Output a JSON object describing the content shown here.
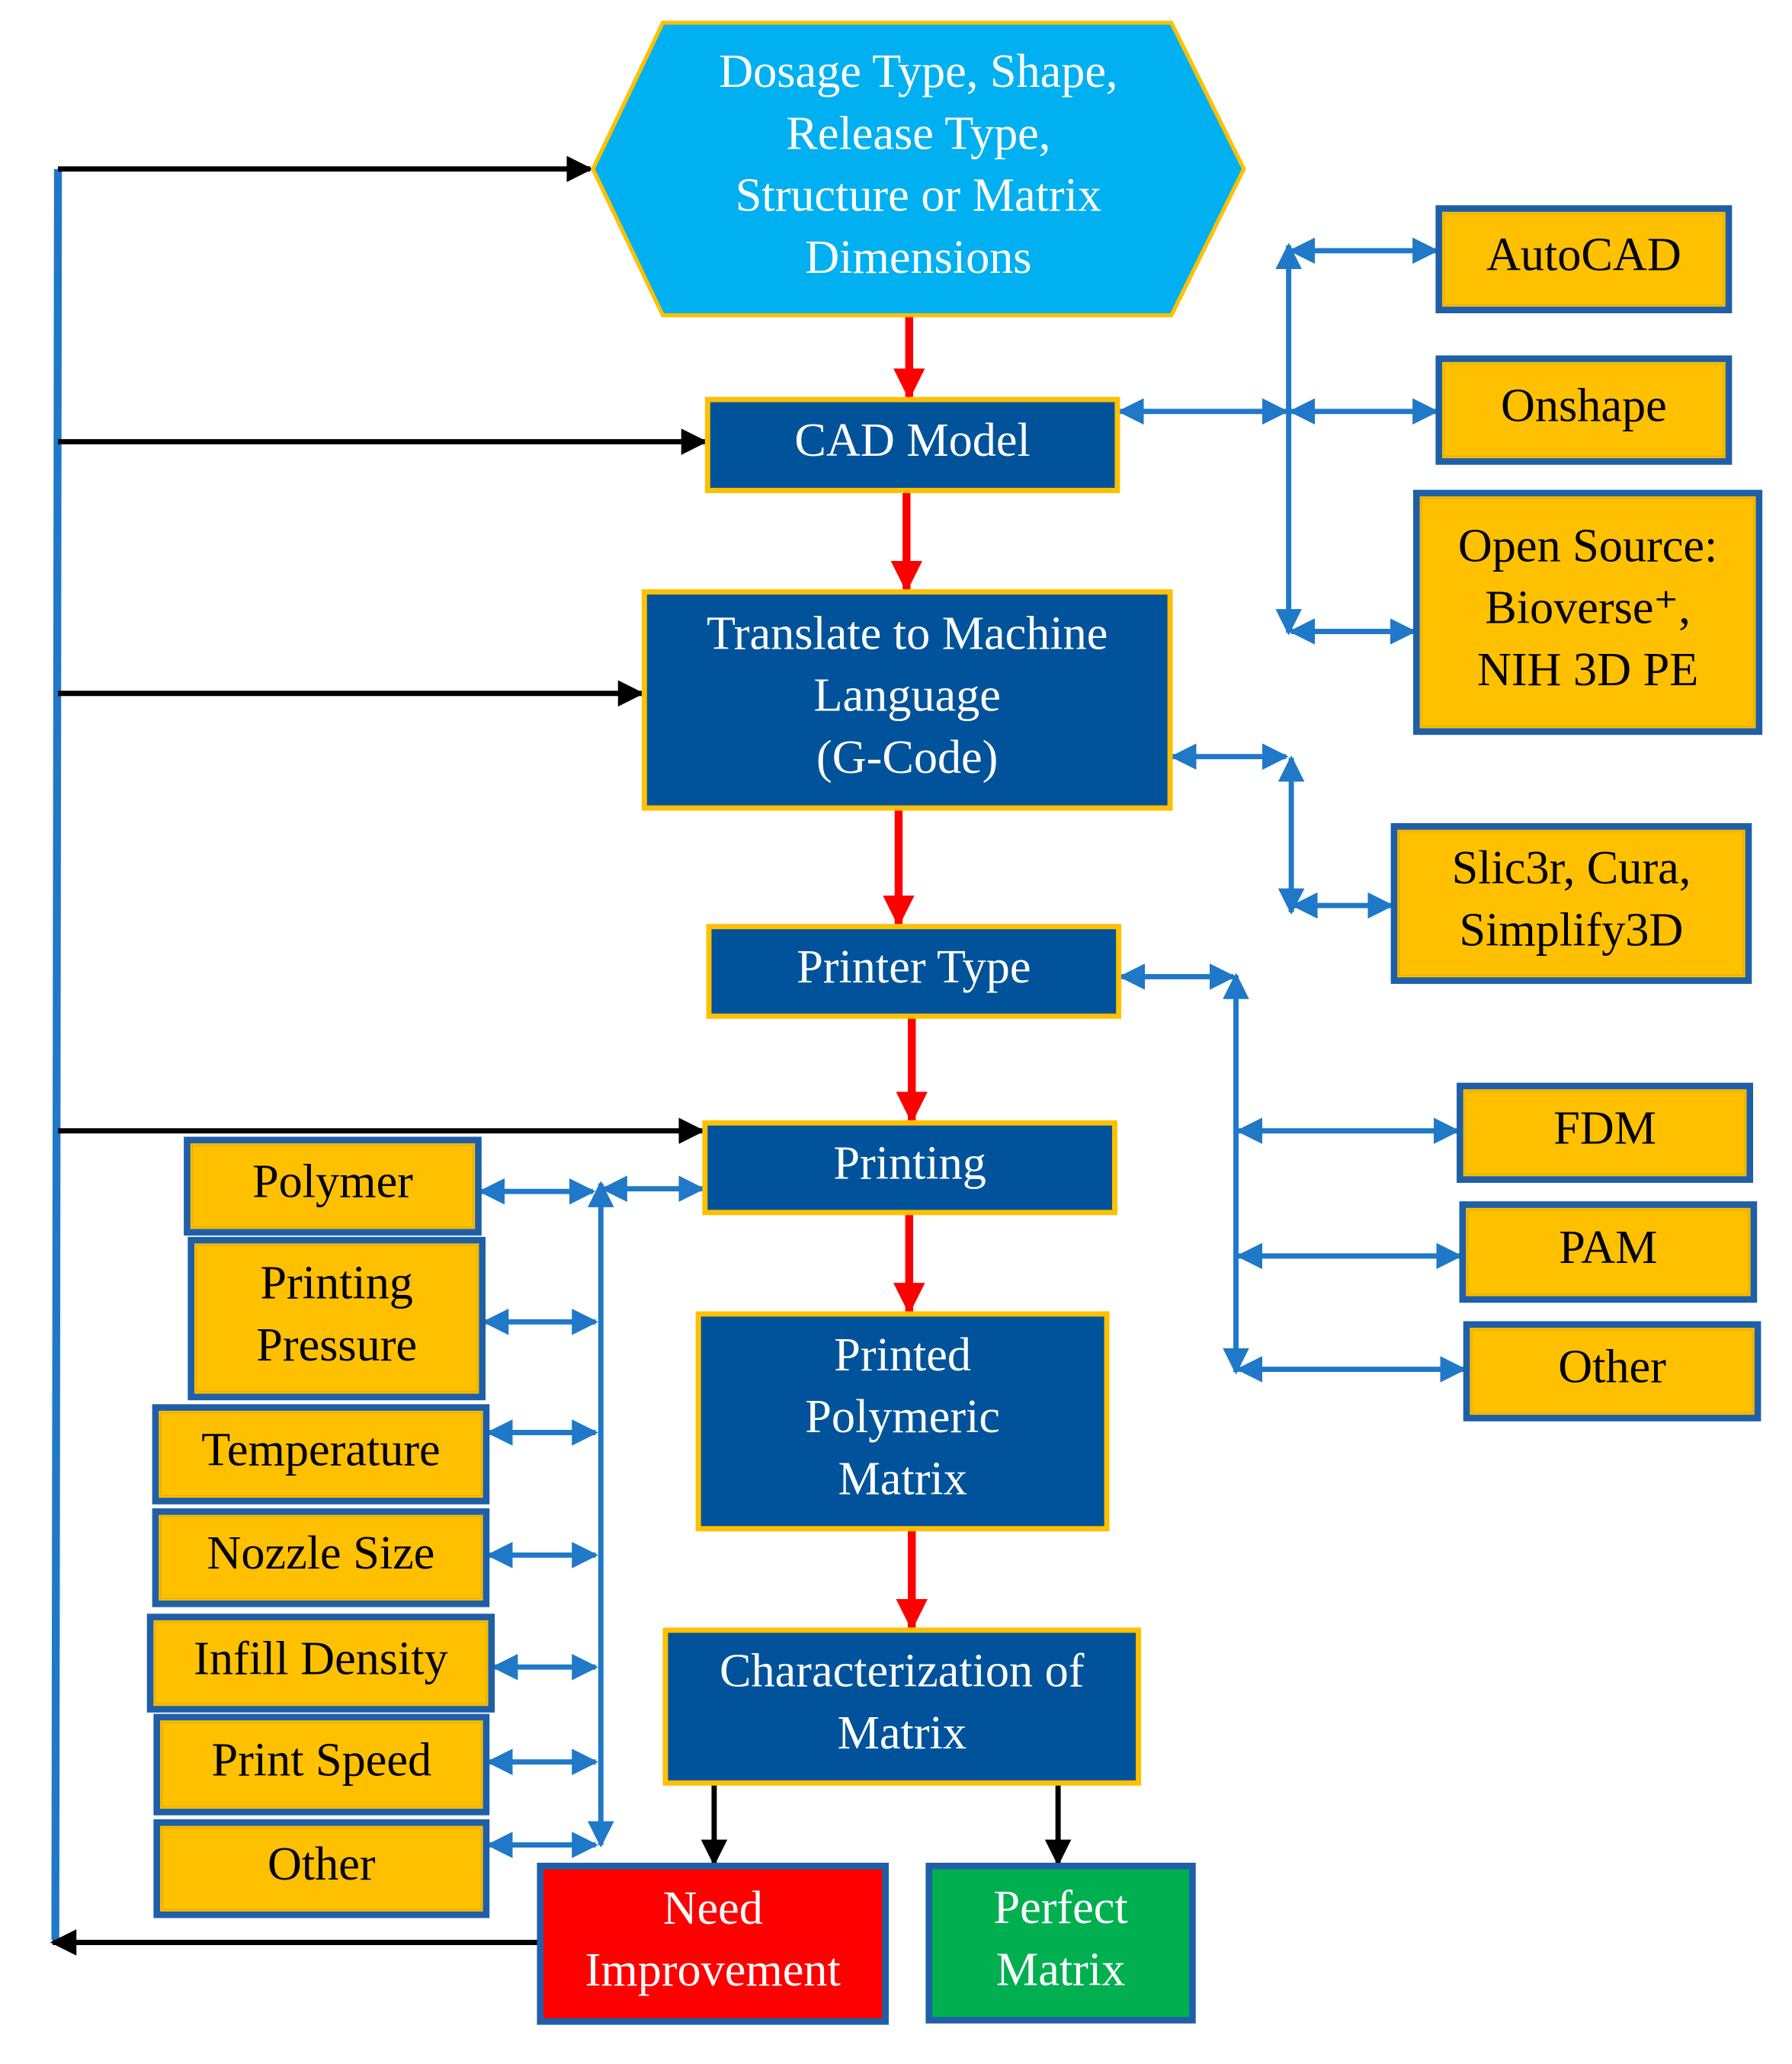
{
  "colors": {
    "input_hexagon": "#00B0F0",
    "process_box": "#00539B",
    "option_box": "#FFC000",
    "border_gold": "#FFC000",
    "border_blue": "#1F5FA8",
    "need_improvement": "#FF0000",
    "perfect_matrix": "#00B050",
    "flow_arrow": "#FF0000",
    "link_arrow": "#1F78C8",
    "feedback_arrow": "#000000"
  },
  "main_flow": {
    "input": {
      "lines": [
        "Dosage Type, Shape,",
        "Release Type,",
        "Structure or Matrix",
        "Dimensions"
      ]
    },
    "cad_model": {
      "lines": [
        "CAD Model"
      ]
    },
    "translate": {
      "lines": [
        "Translate to Machine",
        "Language",
        "(G-Code)"
      ]
    },
    "printer_type": {
      "lines": [
        "Printer Type"
      ]
    },
    "printing": {
      "lines": [
        "Printing"
      ]
    },
    "printed_matrix": {
      "lines": [
        "Printed",
        "Polymeric",
        "Matrix"
      ]
    },
    "characterization": {
      "lines": [
        "Characterization of",
        "Matrix"
      ]
    },
    "need_improvement": {
      "lines": [
        "Need",
        "Improvement"
      ]
    },
    "perfect_matrix": {
      "lines": [
        "Perfect",
        "Matrix"
      ]
    }
  },
  "cad_software": [
    {
      "lines": [
        "AutoCAD"
      ]
    },
    {
      "lines": [
        "Onshape"
      ]
    },
    {
      "lines": [
        "Open Source:",
        "Bioverse⁺,",
        "NIH 3D PE"
      ]
    }
  ],
  "slicers": [
    {
      "lines": [
        "Slic3r, Cura,",
        "Simplify3D"
      ]
    }
  ],
  "printer_types": [
    {
      "lines": [
        "FDM"
      ]
    },
    {
      "lines": [
        "PAM"
      ]
    },
    {
      "lines": [
        "Other"
      ]
    }
  ],
  "print_parameters": [
    {
      "lines": [
        "Polymer"
      ]
    },
    {
      "lines": [
        "Printing",
        "Pressure"
      ]
    },
    {
      "lines": [
        "Temperature"
      ]
    },
    {
      "lines": [
        "Nozzle Size"
      ]
    },
    {
      "lines": [
        "Infill Density"
      ]
    },
    {
      "lines": [
        "Print Speed"
      ]
    },
    {
      "lines": [
        "Other"
      ]
    }
  ]
}
